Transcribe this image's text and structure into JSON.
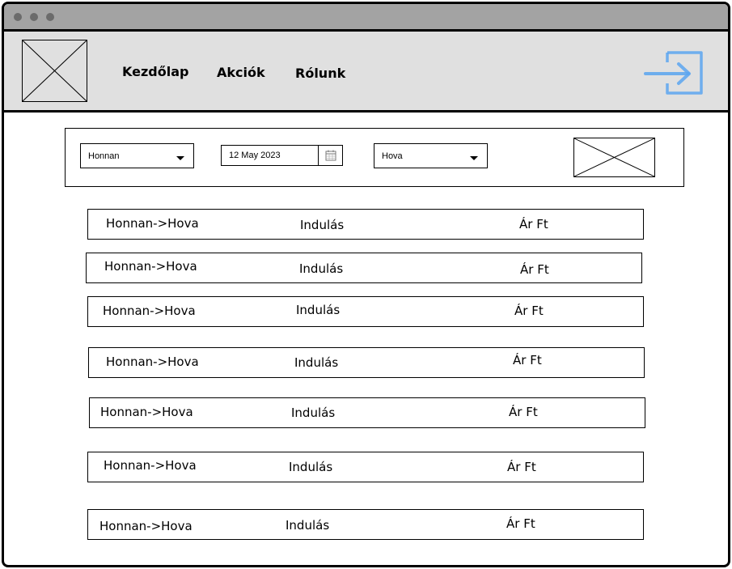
{
  "nav": {
    "items": [
      "Kezdőlap",
      "Akciók",
      "Rólunk"
    ]
  },
  "search": {
    "from_label": "Honnan",
    "date_value": "12 May 2023",
    "to_label": "Hova"
  },
  "results": [
    {
      "route": "Honnan->Hova",
      "departure": "Indulás",
      "price": "Ár Ft"
    },
    {
      "route": "Honnan->Hova",
      "departure": "Indulás",
      "price": "Ár Ft"
    },
    {
      "route": "Honnan->Hova",
      "departure": "Indulás",
      "price": "Ár Ft"
    },
    {
      "route": "Honnan->Hova",
      "departure": "Indulás",
      "price": "Ár Ft"
    },
    {
      "route": "Honnan->Hova",
      "departure": "Indulás",
      "price": "Ár Ft"
    },
    {
      "route": "Honnan->Hova",
      "departure": "Indulás",
      "price": "Ár Ft"
    },
    {
      "route": "Honnan->Hova",
      "departure": "Indulás",
      "price": "Ár Ft"
    }
  ],
  "icons": {
    "logo": "image-placeholder-icon",
    "login": "login-arrow-icon",
    "calendar": "calendar-icon",
    "dropdown": "chevron-down-icon"
  },
  "colors": {
    "titlebar": "#a3a3a3",
    "header": "#e0e0e0",
    "accent": "#5aa5f0"
  }
}
